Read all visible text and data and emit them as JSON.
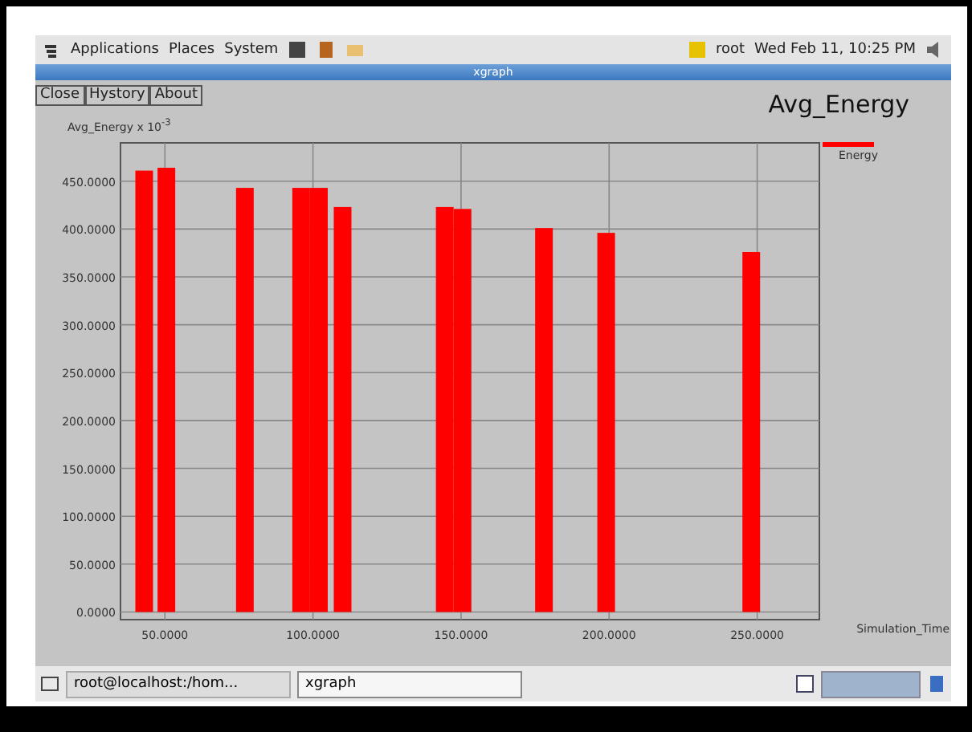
{
  "top_panel": {
    "menus": [
      "Applications",
      "Places",
      "System"
    ],
    "user": "root",
    "clock": "Wed Feb 11, 10:25 PM"
  },
  "window": {
    "title": "xgraph"
  },
  "buttons": [
    "Close",
    "Hystory",
    "About"
  ],
  "graph": {
    "chart_data": {
      "type": "bar",
      "title": "Avg_Energy",
      "ylabel": "Avg_Energy x 10$^{-3}$",
      "xlabel": "Simulation_Time",
      "x": [
        43,
        50.5,
        77,
        96,
        102,
        110,
        144.5,
        150.5,
        178,
        199,
        248
      ],
      "series": [
        {
          "name": "Energy",
          "color": "#ff0000",
          "values": [
            461,
            464,
            443,
            443,
            443,
            423,
            423,
            421,
            401,
            396,
            376
          ]
        }
      ],
      "grid": true,
      "xlim": [
        35,
        271
      ],
      "ylim": [
        -8,
        490
      ],
      "xticks": [
        {
          "value": 50,
          "label": "50.0000"
        },
        {
          "value": 100,
          "label": "100.0000"
        },
        {
          "value": 150,
          "label": "150.0000"
        },
        {
          "value": 200,
          "label": "200.0000"
        },
        {
          "value": 250,
          "label": "250.0000"
        }
      ],
      "yticks": [
        {
          "value": 0,
          "label": "0.0000"
        },
        {
          "value": 50,
          "label": "50.0000"
        },
        {
          "value": 100,
          "label": "100.0000"
        },
        {
          "value": 150,
          "label": "150.0000"
        },
        {
          "value": 200,
          "label": "200.0000"
        },
        {
          "value": 250,
          "label": "250.0000"
        },
        {
          "value": 300,
          "label": "300.0000"
        },
        {
          "value": 350,
          "label": "350.0000"
        },
        {
          "value": 400,
          "label": "400.0000"
        },
        {
          "value": 450,
          "label": "450.0000"
        }
      ]
    }
  },
  "taskbar": {
    "tasks": [
      {
        "label": "root@localhost:/hom...",
        "selected": false
      },
      {
        "label": "xgraph",
        "selected": true
      }
    ]
  }
}
